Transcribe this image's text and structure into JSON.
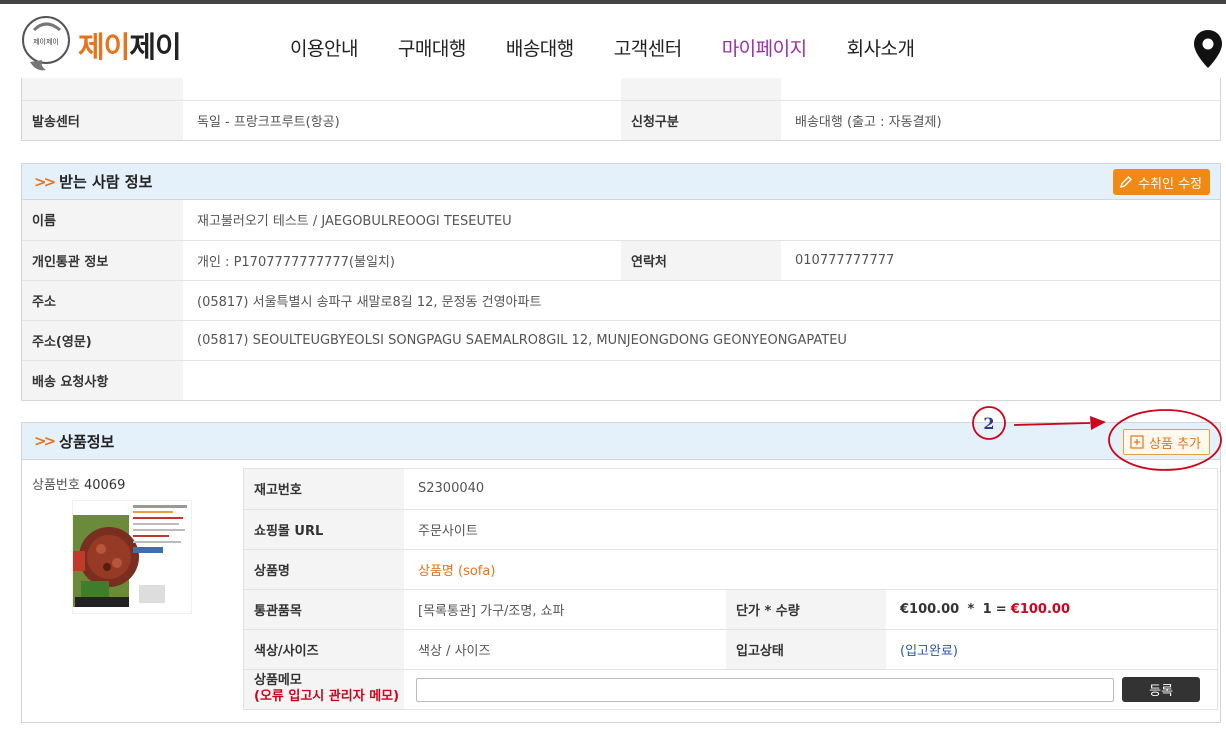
{
  "header": {
    "logo_badge": "제이제이",
    "logo_part1": "제이",
    "logo_part2": "제이",
    "nav": [
      {
        "label": "이용안내"
      },
      {
        "label": "구매대행"
      },
      {
        "label": "배송대행"
      },
      {
        "label": "고객센터"
      },
      {
        "label": "마이페이지"
      },
      {
        "label": "회사소개"
      }
    ],
    "active_nav": "마이페이지"
  },
  "shipping": {
    "center_label": "발송센터",
    "center_value": "독일 - 프랑크프루트(항공)",
    "type_label": "신청구분",
    "type_value": "배송대행 (출고 : 자동결제)"
  },
  "recipient": {
    "title": "받는 사람 정보",
    "edit_button": "수취인 수정",
    "name_label": "이름",
    "name_value": "재고불러오기 테스트 / JAEGOBULREOOGI TESEUTEU",
    "customs_label": "개인통관 정보",
    "customs_value": "개인 : P1707777777777(불일치)",
    "phone_label": "연락처",
    "phone_value": "010777777777",
    "address_label": "주소",
    "address_value": "(05817) 서울특별시 송파구 새말로8길 12, 문정동 건영아파트",
    "address_en_label": "주소(영문)",
    "address_en_value": "(05817) SEOULTEUGBYEOLSI SONGPAGU SAEMALRO8GIL 12, MUNJEONGDONG GEONYEONGAPATEU",
    "request_label": "배송 요청사항",
    "request_value": ""
  },
  "product": {
    "title": "상품정보",
    "add_button": "상품 추가",
    "number_label": "상품번호",
    "number_value": "40069",
    "stock_label": "재고번호",
    "stock_value": "S2300040",
    "url_label": "쇼핑몰 URL",
    "url_value": "주문사이트",
    "name_label": "상품명",
    "name_value": "상품명 (sofa)",
    "customs_item_label": "통관품목",
    "customs_item_value": "[목록통관] 가구/조명, 쇼파",
    "price_label": "단가 * 수량",
    "unit_price": "€100.00",
    "times": "*",
    "qty": "1",
    "equals": "=",
    "total": "€100.00",
    "color_label": "색상/사이즈",
    "color_value": "색상 / 사이즈",
    "status_label": "입고상태",
    "status_value": "(입고완료)",
    "memo_label": "상품메모",
    "memo_warning": "(오류 입고시 관리자 메모)",
    "memo_value": "",
    "register_button": "등록"
  },
  "annotation": {
    "step_number": "2",
    "color": "#d0021b"
  },
  "colors": {
    "accent_orange": "#e8731a",
    "nav_active": "#9b2fa8",
    "section_header_bg": "#e4f0fa",
    "price_red": "#d0021b"
  }
}
